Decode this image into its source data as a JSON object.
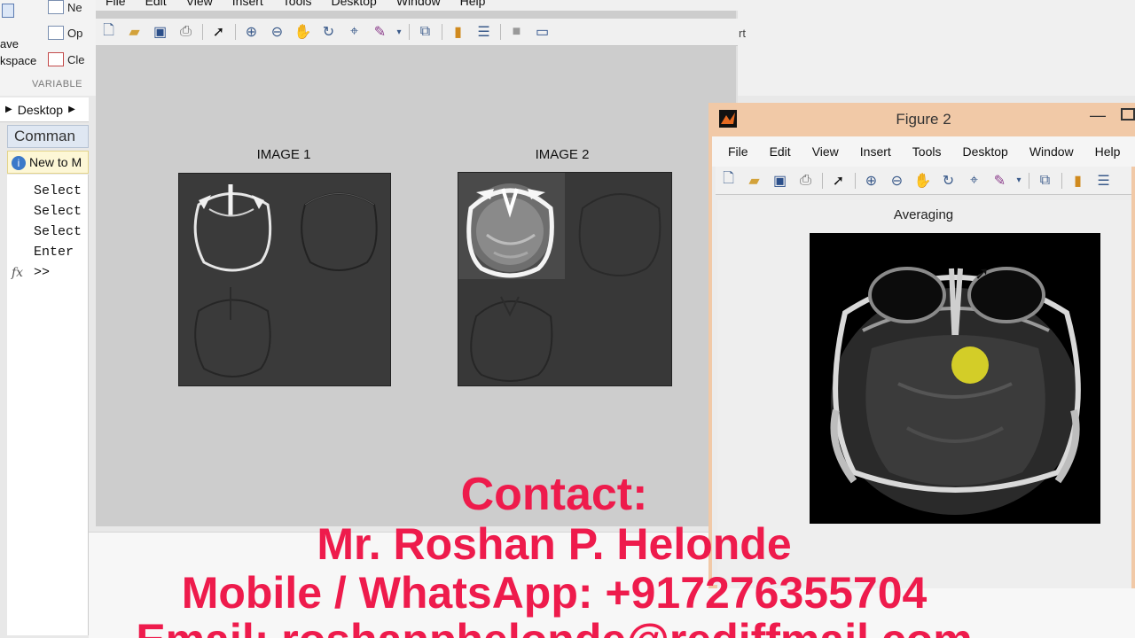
{
  "matlab": {
    "toolstrip": {
      "new_label": "Ne",
      "open_label": "Op",
      "clear_label": "Cle",
      "save_ws_1": "ave",
      "save_ws_2": "kspace",
      "section_label": "VARIABLE",
      "right_fragment": "rt"
    },
    "address": {
      "label": "Desktop"
    },
    "command_window": {
      "title": "Comman",
      "new_to_label": "New to M",
      "lines": [
        "Select",
        "Select",
        "Select",
        "Enter"
      ],
      "prompt": ">>"
    }
  },
  "figure1": {
    "menu": [
      "File",
      "Edit",
      "View",
      "Insert",
      "Tools",
      "Desktop",
      "Window",
      "Help"
    ],
    "axes": [
      {
        "title": "IMAGE 1"
      },
      {
        "title": "IMAGE 2"
      }
    ]
  },
  "figure2": {
    "window_title": "Figure 2",
    "menu": [
      "File",
      "Edit",
      "View",
      "Insert",
      "Tools",
      "Desktop",
      "Window",
      "Help"
    ],
    "axes_title": "Averaging"
  },
  "toolbar_icons": [
    "new-file-icon",
    "open-file-icon",
    "save-icon",
    "print-icon",
    "pointer-icon",
    "zoom-in-icon",
    "zoom-out-icon",
    "pan-hand-icon",
    "rotate-3d-icon",
    "data-cursor-icon",
    "brush-icon",
    "link-plot-icon",
    "colorbar-icon",
    "legend-icon"
  ],
  "overlay": {
    "line1": "Contact:",
    "line2": "Mr. Roshan P. Helonde",
    "line3": "Mobile / WhatsApp: +917276355704",
    "line4": "Email: roshanphelonde@rediffmail.com",
    "color": "#ee1b4c"
  }
}
